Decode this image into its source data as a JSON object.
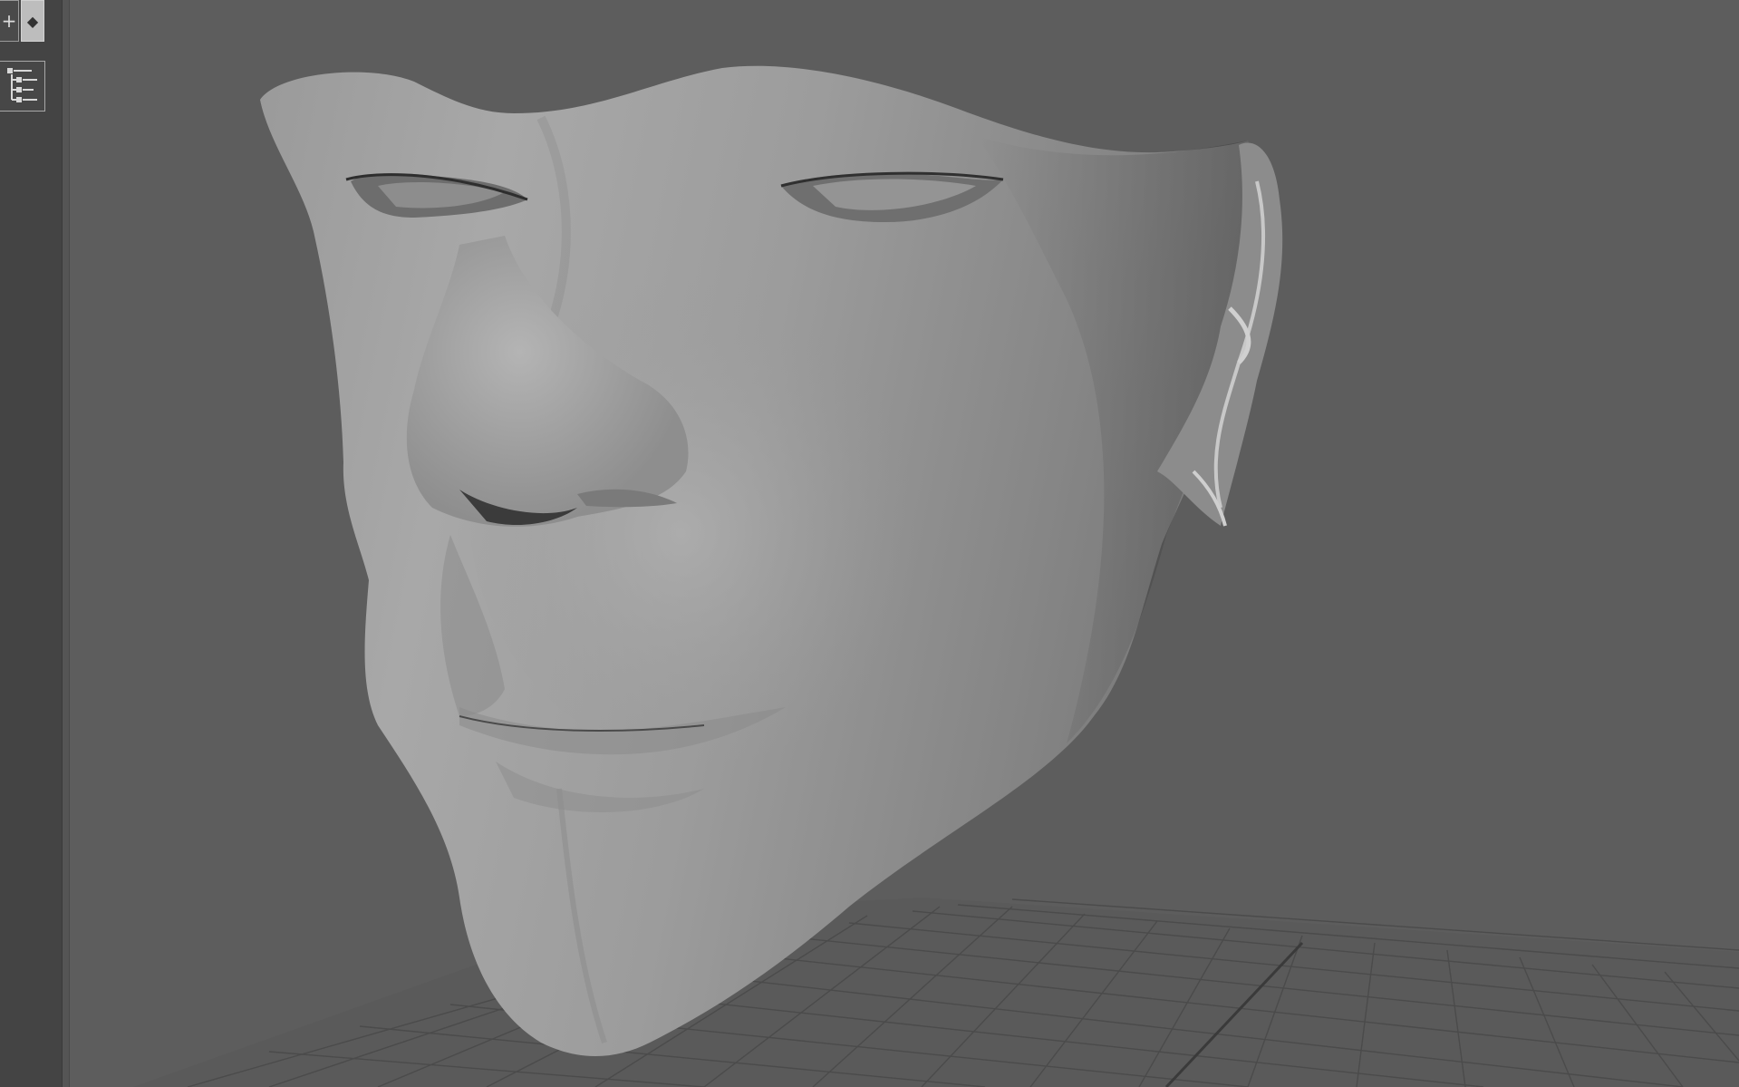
{
  "app": {
    "name": "3D viewport",
    "accent": "#bdbdbd",
    "background": "#5d5d5d"
  },
  "left_shelf": {
    "buttons": [
      {
        "name": "add-button",
        "icon": "plus-icon",
        "glyph": "+"
      },
      {
        "name": "toggle-button",
        "icon": "diamond-icon",
        "glyph": "◆"
      },
      {
        "name": "outliner-button",
        "icon": "outliner-icon"
      }
    ]
  },
  "viewport": {
    "object": "head-mesh",
    "grid": true,
    "shading": "smooth-shaded"
  }
}
